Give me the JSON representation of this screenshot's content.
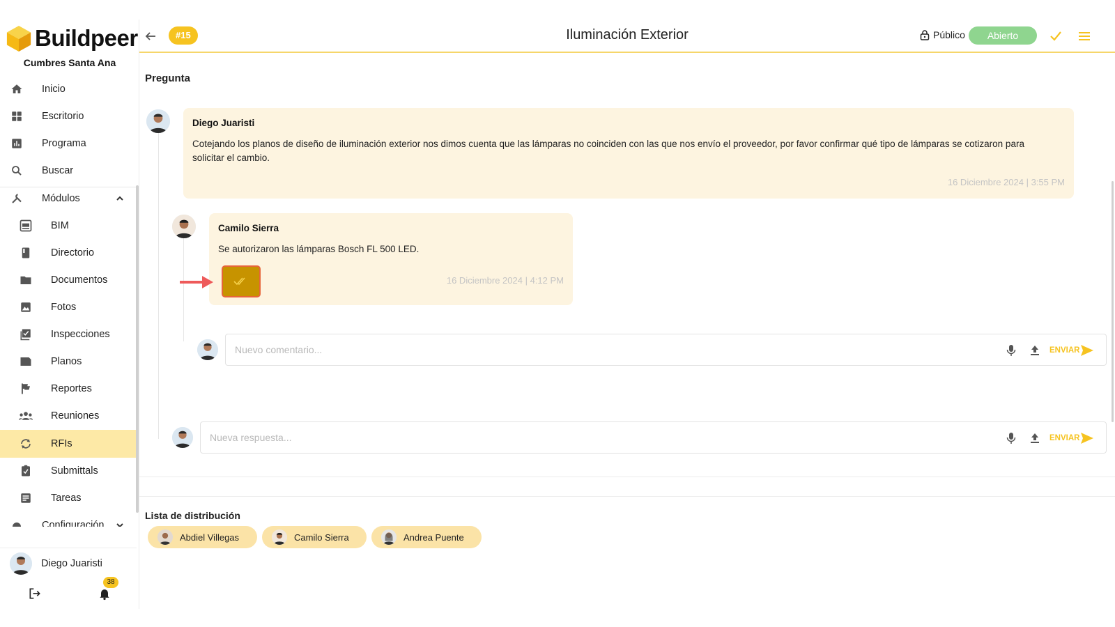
{
  "app": {
    "brand": "Buildpeer",
    "project": "Cumbres Santa Ana"
  },
  "sidebar": {
    "items": [
      {
        "label": "Inicio",
        "icon": "home-icon"
      },
      {
        "label": "Escritorio",
        "icon": "dashboard-icon"
      },
      {
        "label": "Programa",
        "icon": "bar-chart-icon"
      },
      {
        "label": "Buscar",
        "icon": "search-icon"
      }
    ],
    "modules_label": "Módulos",
    "modules": [
      {
        "label": "BIM",
        "icon": "bim-icon"
      },
      {
        "label": "Directorio",
        "icon": "book-icon"
      },
      {
        "label": "Documentos",
        "icon": "folder-icon"
      },
      {
        "label": "Fotos",
        "icon": "image-icon"
      },
      {
        "label": "Inspecciones",
        "icon": "checklist-icon"
      },
      {
        "label": "Planos",
        "icon": "plans-icon"
      },
      {
        "label": "Reportes",
        "icon": "flag-icon"
      },
      {
        "label": "Reuniones",
        "icon": "group-icon"
      },
      {
        "label": "RFIs",
        "icon": "sync-icon",
        "active": true
      },
      {
        "label": "Submittals",
        "icon": "clipboard-check-icon"
      },
      {
        "label": "Tareas",
        "icon": "task-icon"
      }
    ],
    "config_label": "Configuración",
    "user_name": "Diego Juaristi",
    "notifications_count": "38"
  },
  "header": {
    "rfi_number": "#15",
    "title": "Iluminación Exterior",
    "visibility": "Público",
    "status": "Abierto",
    "colors": {
      "accent": "#f6c320",
      "status": "#8fd58f",
      "active_nav": "#fde9a6"
    }
  },
  "thread": {
    "section_title": "Pregunta",
    "question": {
      "author": "Diego Juaristi",
      "text": "Cotejando los planos de diseño de iluminación exterior nos dimos cuenta que las lámparas no coinciden con las que nos envío el proveedor, por favor confirmar qué tipo de lámparas se cotizaron para solicitar el cambio.",
      "timestamp": "16 Diciembre 2024 | 3:55 PM"
    },
    "answer": {
      "author": "Camilo Sierra",
      "text": "Se autorizaron las lámparas Bosch FL 500 LED.",
      "timestamp": "16 Diciembre 2024 | 4:12 PM"
    },
    "comment_input": {
      "placeholder": "Nuevo comentario...",
      "send_label": "ENVIAR"
    },
    "reply_input": {
      "placeholder": "Nueva respuesta...",
      "send_label": "ENVIAR"
    }
  },
  "distribution": {
    "title": "Lista de distribución",
    "people": [
      "Abdiel Villegas",
      "Camilo Sierra",
      "Andrea Puente"
    ]
  }
}
